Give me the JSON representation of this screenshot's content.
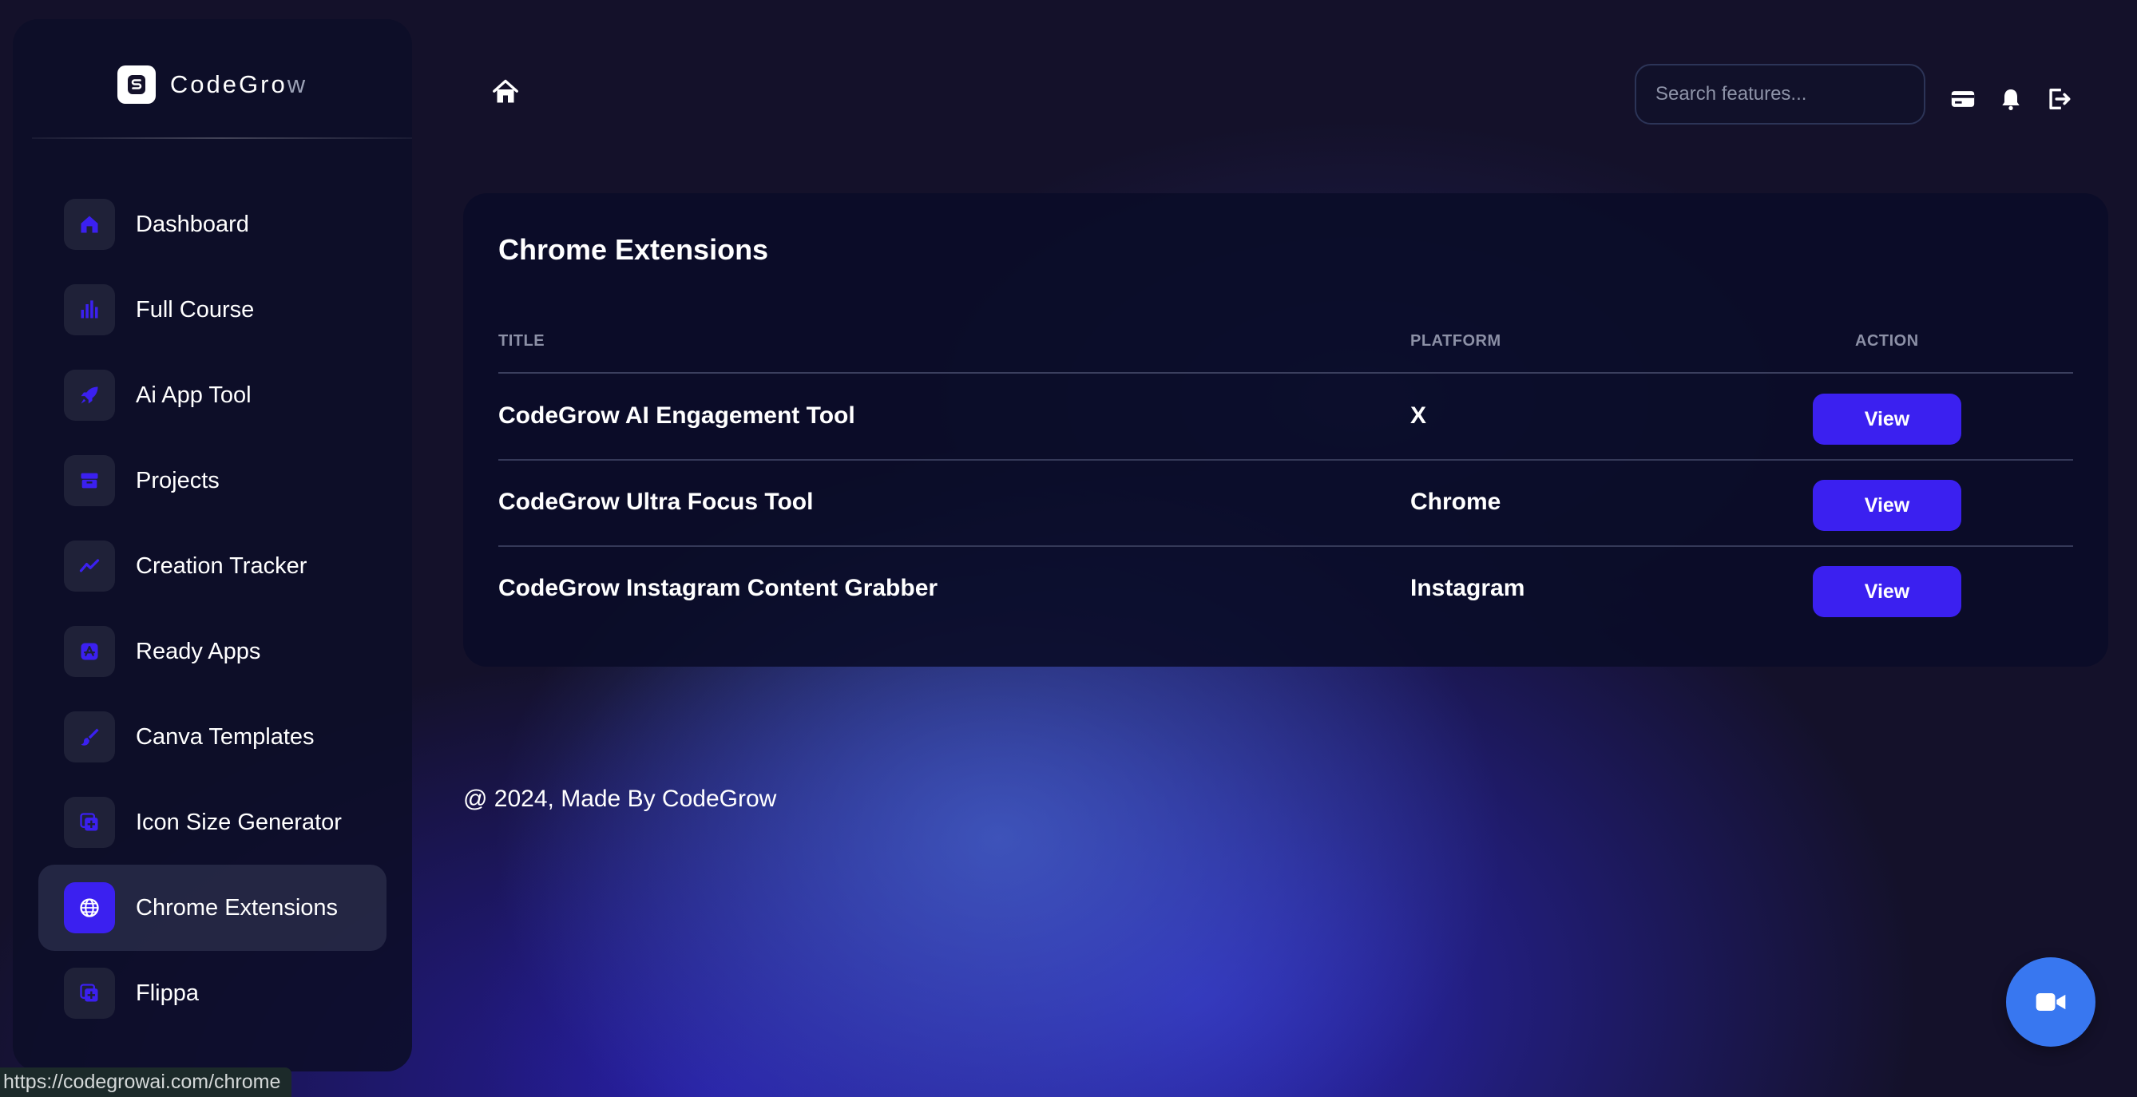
{
  "brand": {
    "name_main": "CodeGro",
    "name_fade": "w",
    "logo_icon": "s-logo-icon"
  },
  "sidebar": {
    "items": [
      {
        "label": "Dashboard",
        "icon": "home-icon",
        "active": false
      },
      {
        "label": "Full Course",
        "icon": "bar-chart-icon",
        "active": false
      },
      {
        "label": "Ai App Tool",
        "icon": "rocket-icon",
        "active": false
      },
      {
        "label": "Projects",
        "icon": "archive-icon",
        "active": false
      },
      {
        "label": "Creation Tracker",
        "icon": "trend-line-icon",
        "active": false
      },
      {
        "label": "Ready Apps",
        "icon": "app-store-icon",
        "active": false
      },
      {
        "label": "Canva Templates",
        "icon": "brush-icon",
        "active": false
      },
      {
        "label": "Icon Size Generator",
        "icon": "copy-plus-icon",
        "active": false
      },
      {
        "label": "Chrome Extensions",
        "icon": "globe-icon",
        "active": true
      },
      {
        "label": "Flippa",
        "icon": "copy-plus-icon",
        "active": false
      }
    ]
  },
  "header": {
    "search_placeholder": "Search features...",
    "icons": [
      "home-icon",
      "credit-card-icon",
      "bell-icon",
      "logout-icon"
    ]
  },
  "card": {
    "title": "Chrome Extensions",
    "columns": {
      "title": "TITLE",
      "platform": "PLATFORM",
      "action": "ACTION"
    },
    "rows": [
      {
        "title": "CodeGrow AI Engagement Tool",
        "platform": "X",
        "action": "View"
      },
      {
        "title": "CodeGrow Ultra Focus Tool",
        "platform": "Chrome",
        "action": "View"
      },
      {
        "title": "CodeGrow Instagram Content Grabber",
        "platform": "Instagram",
        "action": "View"
      }
    ]
  },
  "footer": {
    "text": "@ 2024, Made By CodeGrow"
  },
  "status_bar": {
    "url": "https://codegrowai.com/chrome"
  },
  "fab": {
    "icon": "video-camera-icon"
  },
  "colors": {
    "accent": "#3b20f0",
    "fab": "#3877f0",
    "background": "#14112a"
  }
}
